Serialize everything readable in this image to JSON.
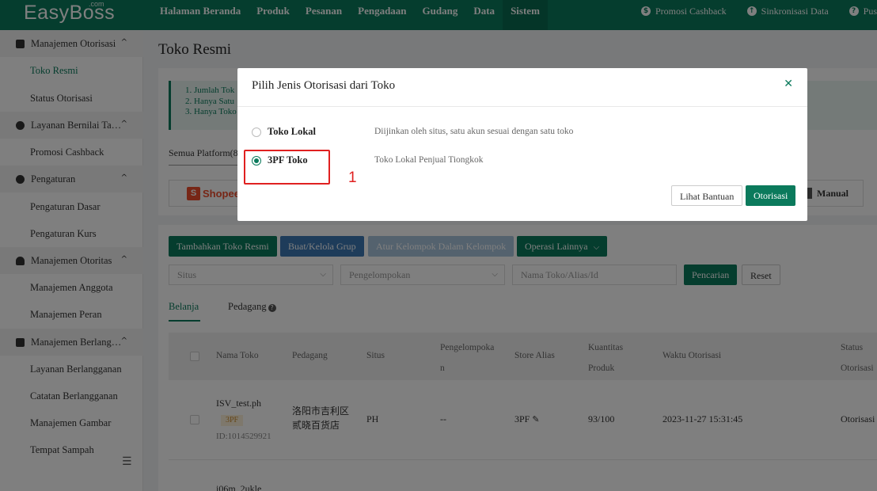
{
  "topbar": {
    "logo": "EasyBoss",
    "logo_suffix": ".com",
    "nav": [
      "Halaman Beranda",
      "Produk",
      "Pesanan",
      "Pengadaan",
      "Gudang",
      "Data",
      "Sistem"
    ],
    "active_nav": "Sistem",
    "right": [
      {
        "label": "Promosi Cashback",
        "icon": "cashback-icon"
      },
      {
        "label": "Sinkronisasi Data",
        "icon": "cloud-sync-icon"
      },
      {
        "label": "Pus",
        "icon": "help-icon"
      }
    ]
  },
  "sidebar": {
    "groups": [
      {
        "label": "Manajemen Otorisasi",
        "icon": "store-icon",
        "items": [
          "Toko Resmi",
          "Status Otorisasi"
        ]
      },
      {
        "label": "Layanan Bernilai Ta…",
        "icon": "value-service-icon",
        "items": [
          "Promosi Cashback"
        ]
      },
      {
        "label": "Pengaturan",
        "icon": "gear-icon",
        "items": [
          "Pengaturan Dasar",
          "Pengaturan Kurs"
        ]
      },
      {
        "label": "Manajemen Otoritas",
        "icon": "user-icon",
        "items": [
          "Manajemen Anggota",
          "Manajemen Peran"
        ]
      },
      {
        "label": "Manajemen Berlang…",
        "icon": "subscription-icon",
        "items": [
          "Layanan Berlangganan",
          "Catatan Berlangganan",
          "Manajemen Gambar",
          "Tempat Sampah"
        ]
      }
    ],
    "active_item": "Toko Resmi"
  },
  "main": {
    "title": "Toko Resmi",
    "notice": [
      "1. Jumlah Tok",
      "2. Hanya Satu",
      "3. Hanya Toko"
    ],
    "platform_tab": "Semua Platform(8",
    "shopee_label": "Shopee",
    "manual_label": "Manual",
    "buttons": {
      "add": "Tambahkan Toko Resmi",
      "group": "Buat/Kelola Grup",
      "arrange": "Atur Kelompok Dalam Kelompok",
      "more": "Operasi Lainnya"
    },
    "filters": {
      "site": "Situs",
      "grouping": "Pengelompokan",
      "search_placeholder": "Nama Toko/Alias/Id",
      "search_btn": "Pencarian",
      "reset_btn": "Reset"
    },
    "subtabs": [
      "Belanja",
      "Pedagang"
    ],
    "table": {
      "headers": [
        "Nama Toko",
        "Pedagang",
        "Situs",
        "Pengelompokan",
        "Store Alias",
        "Kuantitas Produk",
        "Waktu Otorisasi",
        "Status Otorisasi"
      ],
      "header_lines": {
        "grouping": [
          "Pengelompoka",
          "n"
        ],
        "qty": [
          "Kuantitas",
          "Produk"
        ],
        "status": [
          "Status",
          "Otorisasi"
        ]
      },
      "rows": [
        {
          "name": "ISV_test.ph",
          "tag": "3PF",
          "id": "ID:1014529921",
          "merchant": [
            "洛阳市吉利区",
            "贰晓百货店"
          ],
          "site": "PH",
          "grouping": "--",
          "alias": "3PF",
          "qty": "93/100",
          "time": "2023-11-27 15:31:45",
          "status": "Otorisasi"
        },
        {
          "name": "i06m_2ukle"
        }
      ]
    }
  },
  "modal": {
    "title": "Pilih Jenis Otorisasi dari Toko",
    "options": [
      {
        "label": "Toko Lokal",
        "desc": "Diijinkan oleh situs, satu akun sesuai dengan satu toko",
        "checked": false
      },
      {
        "label": "3PF Toko",
        "desc": "Toko Lokal Penjual Tiongkok",
        "checked": true
      }
    ],
    "help_btn": "Lihat Bantuan",
    "confirm_btn": "Otorisasi"
  },
  "annotation": {
    "number": "1",
    "color": "#e02020"
  },
  "colors": {
    "brand": "#0b7a5c",
    "blue": "#3c78b5",
    "shopee": "#ee4d2d"
  }
}
